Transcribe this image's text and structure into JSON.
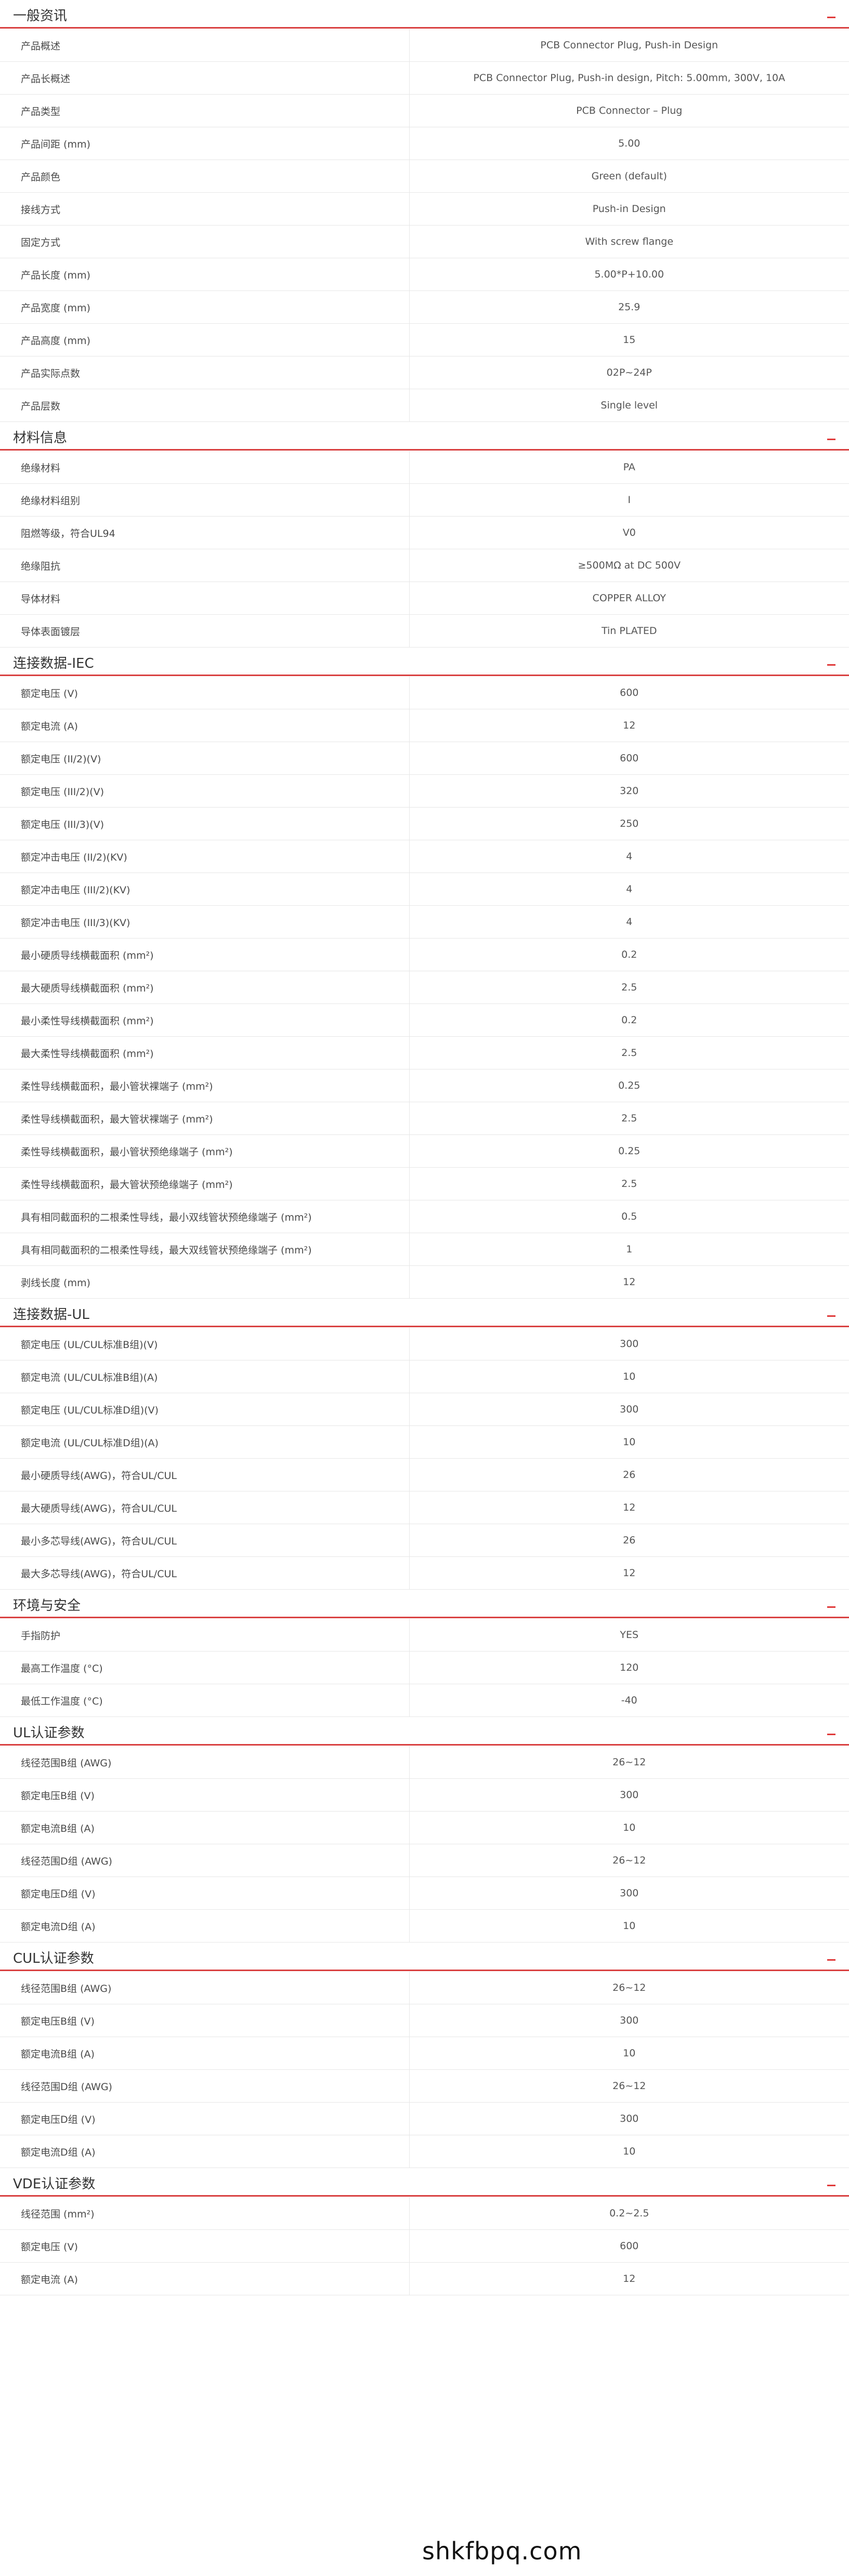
{
  "sections": [
    {
      "title": "一般资讯",
      "rows": [
        [
          "产品概述",
          "PCB Connector Plug, Push-in Design"
        ],
        [
          "产品长概述",
          "PCB Connector Plug, Push-in design, Pitch: 5.00mm, 300V, 10A"
        ],
        [
          "产品类型",
          "PCB Connector – Plug"
        ],
        [
          "产品间距 (mm)",
          "5.00"
        ],
        [
          "产品颜色",
          "Green (default)"
        ],
        [
          "接线方式",
          "Push-in Design"
        ],
        [
          "固定方式",
          "With screw flange"
        ],
        [
          "产品长度 (mm)",
          "5.00*P+10.00"
        ],
        [
          "产品宽度 (mm)",
          "25.9"
        ],
        [
          "产品高度 (mm)",
          "15"
        ],
        [
          "产品实际点数",
          "02P~24P"
        ],
        [
          "产品层数",
          "Single level"
        ]
      ]
    },
    {
      "title": "材料信息",
      "rows": [
        [
          "绝缘材料",
          "PA"
        ],
        [
          "绝缘材料组别",
          "I"
        ],
        [
          "阻燃等级，符合UL94",
          "V0"
        ],
        [
          "绝缘阻抗",
          "≥500MΩ at DC 500V"
        ],
        [
          "导体材料",
          "COPPER ALLOY"
        ],
        [
          "导体表面镀层",
          "Tin PLATED"
        ]
      ]
    },
    {
      "title": "连接数据-IEC",
      "rows": [
        [
          "额定电压 (V)",
          "600"
        ],
        [
          "额定电流 (A)",
          "12"
        ],
        [
          "额定电压 (II/2)(V)",
          "600"
        ],
        [
          "额定电压 (III/2)(V)",
          "320"
        ],
        [
          "额定电压 (III/3)(V)",
          "250"
        ],
        [
          "额定冲击电压 (II/2)(KV)",
          "4"
        ],
        [
          "额定冲击电压 (III/2)(KV)",
          "4"
        ],
        [
          "额定冲击电压 (III/3)(KV)",
          "4"
        ],
        [
          "最小硬质导线横截面积 (mm²)",
          "0.2"
        ],
        [
          "最大硬质导线横截面积 (mm²)",
          "2.5"
        ],
        [
          "最小柔性导线横截面积 (mm²)",
          "0.2"
        ],
        [
          "最大柔性导线横截面积 (mm²)",
          "2.5"
        ],
        [
          "柔性导线横截面积，最小管状裸端子 (mm²)",
          "0.25"
        ],
        [
          "柔性导线横截面积，最大管状裸端子 (mm²)",
          "2.5"
        ],
        [
          "柔性导线横截面积，最小管状预绝缘端子 (mm²)",
          "0.25"
        ],
        [
          "柔性导线横截面积，最大管状预绝缘端子 (mm²)",
          "2.5"
        ],
        [
          "具有相同截面积的二根柔性导线，最小双线管状预绝缘端子 (mm²)",
          "0.5"
        ],
        [
          "具有相同截面积的二根柔性导线，最大双线管状预绝缘端子 (mm²)",
          "1"
        ],
        [
          "剥线长度 (mm)",
          "12"
        ]
      ]
    },
    {
      "title": "连接数据-UL",
      "rows": [
        [
          "额定电压 (UL/CUL标准B组)(V)",
          "300"
        ],
        [
          "额定电流 (UL/CUL标准B组)(A)",
          "10"
        ],
        [
          "额定电压 (UL/CUL标准D组)(V)",
          "300"
        ],
        [
          "额定电流 (UL/CUL标准D组)(A)",
          "10"
        ],
        [
          "最小硬质导线(AWG)，符合UL/CUL",
          "26"
        ],
        [
          "最大硬质导线(AWG)，符合UL/CUL",
          "12"
        ],
        [
          "最小多芯导线(AWG)，符合UL/CUL",
          "26"
        ],
        [
          "最大多芯导线(AWG)，符合UL/CUL",
          "12"
        ]
      ]
    },
    {
      "title": "环境与安全",
      "rows": [
        [
          "手指防护",
          "YES"
        ],
        [
          "最高工作温度 (°C)",
          "120"
        ],
        [
          "最低工作温度 (°C)",
          "-40"
        ]
      ]
    },
    {
      "title": "UL认证参数",
      "rows": [
        [
          "线径范围B组 (AWG)",
          "26~12"
        ],
        [
          "额定电压B组 (V)",
          "300"
        ],
        [
          "额定电流B组 (A)",
          "10"
        ],
        [
          "线径范围D组 (AWG)",
          "26~12"
        ],
        [
          "额定电压D组 (V)",
          "300"
        ],
        [
          "额定电流D组 (A)",
          "10"
        ]
      ]
    },
    {
      "title": "CUL认证参数",
      "rows": [
        [
          "线径范围B组 (AWG)",
          "26~12"
        ],
        [
          "额定电压B组 (V)",
          "300"
        ],
        [
          "额定电流B组 (A)",
          "10"
        ],
        [
          "线径范围D组 (AWG)",
          "26~12"
        ],
        [
          "额定电压D组 (V)",
          "300"
        ],
        [
          "额定电流D组 (A)",
          "10"
        ]
      ]
    },
    {
      "title": "VDE认证参数",
      "rows": [
        [
          "线径范围 (mm²)",
          "0.2~2.5"
        ],
        [
          "额定电压 (V)",
          "600"
        ],
        [
          "额定电流 (A)",
          "12"
        ]
      ]
    }
  ],
  "watermark": "shkfbpq.com"
}
